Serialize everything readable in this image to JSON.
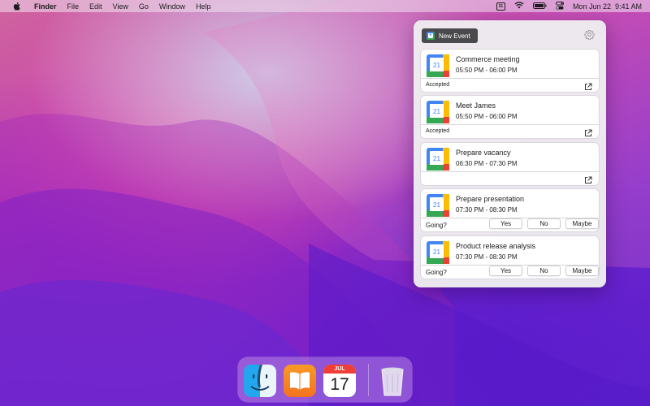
{
  "menubar": {
    "app_name": "Finder",
    "menus": [
      "File",
      "Edit",
      "View",
      "Go",
      "Window",
      "Help"
    ],
    "calendar_status_day": "31",
    "datetime": "Mon Jun 22  9:41 AM"
  },
  "popover": {
    "new_event_label": "New Event",
    "events": [
      {
        "title": "Commerce meeting",
        "time": "05:50 PM - 06:00 PM",
        "status": "Accepted",
        "icon_day": "21"
      },
      {
        "title": "Meet James",
        "time": "05:50 PM - 06:00 PM",
        "status": "Accepted",
        "icon_day": "21"
      },
      {
        "title": "Prepare vacancy",
        "time": "06:30 PM - 07:30 PM",
        "status": "",
        "icon_day": "21"
      },
      {
        "title": "Prepare presentation",
        "time": "07:30 PM - 08:30 PM",
        "going_label": "Going?",
        "icon_day": "21",
        "rsvp": {
          "yes": "Yes",
          "no": "No",
          "maybe": "Maybe"
        }
      },
      {
        "title": "Product release analysis",
        "time": "07:30 PM - 08:30 PM",
        "going_label": "Going?",
        "icon_day": "21",
        "rsvp": {
          "yes": "Yes",
          "no": "No",
          "maybe": "Maybe"
        }
      }
    ]
  },
  "dock": {
    "apps": [
      "finder-icon",
      "books-icon",
      "calendar-icon",
      "trash-icon"
    ],
    "calendar_month": "JUL",
    "calendar_day": "17"
  },
  "colors": {
    "accent_blue": "#4285f4",
    "google_green": "#34a853",
    "google_yellow": "#fbbc04",
    "google_red": "#ea4335",
    "new_event_bg": "#4a4a4c"
  }
}
